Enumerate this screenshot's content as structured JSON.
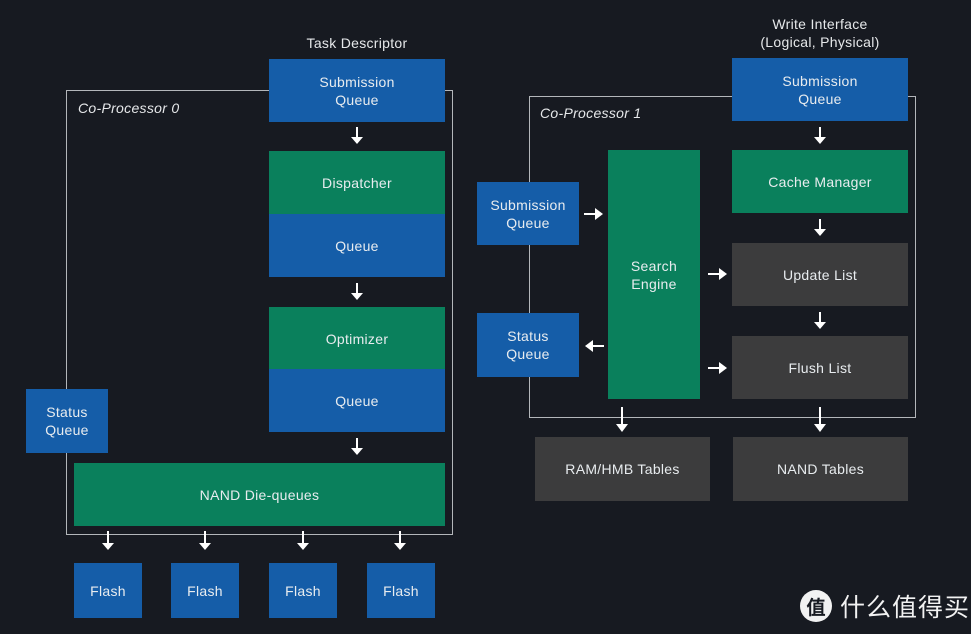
{
  "coprocessor0": {
    "label": "Co-Processor 0",
    "top_caption": "Task Descriptor",
    "submission_queue": "Submission\nQueue",
    "dispatcher": "Dispatcher",
    "dispatcher_queue": "Queue",
    "optimizer": "Optimizer",
    "optimizer_queue": "Queue",
    "status_queue": "Status\nQueue",
    "nand_die_queues": "NAND Die-queues",
    "flash": [
      "Flash",
      "Flash",
      "Flash",
      "Flash"
    ]
  },
  "coprocessor1": {
    "label": "Co-Processor 1",
    "top_caption": "Write Interface\n(Logical, Physical)",
    "write_submission_queue": "Submission\nQueue",
    "cache_manager": "Cache Manager",
    "update_list": "Update List",
    "flush_list": "Flush List",
    "submission_queue": "Submission\nQueue",
    "status_queue": "Status\nQueue",
    "search_engine": "Search\nEngine",
    "ram_hmb_tables": "RAM/HMB Tables",
    "nand_tables": "NAND Tables"
  },
  "watermark": {
    "logo_glyph": "值",
    "text": "什么值得买"
  },
  "colors": {
    "background": "#171a21",
    "queue_blue": "#155da8",
    "processor_green": "#0a805c",
    "storage_gray": "#3c3c3d",
    "frame_border": "#b3b6ba"
  }
}
